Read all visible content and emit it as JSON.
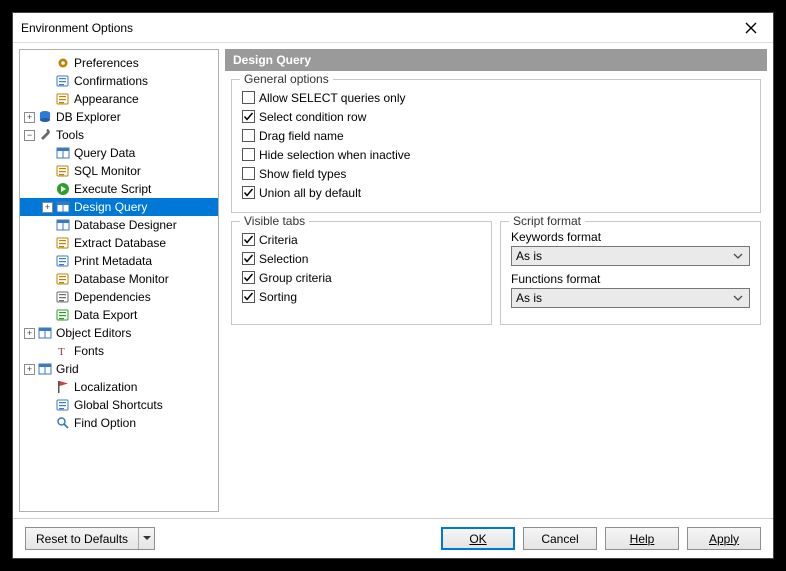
{
  "window": {
    "title": "Environment Options"
  },
  "tree": {
    "items": [
      {
        "label": "Preferences",
        "indent": 1,
        "exp": ""
      },
      {
        "label": "Confirmations",
        "indent": 1,
        "exp": ""
      },
      {
        "label": "Appearance",
        "indent": 1,
        "exp": ""
      },
      {
        "label": "DB Explorer",
        "indent": 0,
        "exp": "+"
      },
      {
        "label": "Tools",
        "indent": 0,
        "exp": "-"
      },
      {
        "label": "Query Data",
        "indent": 1,
        "exp": ""
      },
      {
        "label": "SQL Monitor",
        "indent": 1,
        "exp": ""
      },
      {
        "label": "Execute Script",
        "indent": 1,
        "exp": ""
      },
      {
        "label": "Design Query",
        "indent": 1,
        "exp": "+",
        "selected": true
      },
      {
        "label": "Database Designer",
        "indent": 1,
        "exp": ""
      },
      {
        "label": "Extract Database",
        "indent": 1,
        "exp": ""
      },
      {
        "label": "Print Metadata",
        "indent": 1,
        "exp": ""
      },
      {
        "label": "Database Monitor",
        "indent": 1,
        "exp": ""
      },
      {
        "label": "Dependencies",
        "indent": 1,
        "exp": ""
      },
      {
        "label": "Data Export",
        "indent": 1,
        "exp": ""
      },
      {
        "label": "Object Editors",
        "indent": 0,
        "exp": "+"
      },
      {
        "label": "Fonts",
        "indent": 1,
        "exp": ""
      },
      {
        "label": "Grid",
        "indent": 0,
        "exp": "+"
      },
      {
        "label": "Localization",
        "indent": 1,
        "exp": ""
      },
      {
        "label": "Global Shortcuts",
        "indent": 1,
        "exp": ""
      },
      {
        "label": "Find Option",
        "indent": 1,
        "exp": ""
      }
    ]
  },
  "panel": {
    "header": "Design Query",
    "general": {
      "legend": "General options",
      "items": [
        {
          "label": "Allow SELECT queries only",
          "checked": false
        },
        {
          "label": "Select condition row",
          "checked": true
        },
        {
          "label": "Drag field name",
          "checked": false
        },
        {
          "label": "Hide selection when inactive",
          "checked": false
        },
        {
          "label": "Show field types",
          "checked": false
        },
        {
          "label": "Union all by default",
          "checked": true
        }
      ]
    },
    "visible": {
      "legend": "Visible tabs",
      "items": [
        {
          "label": "Criteria",
          "checked": true
        },
        {
          "label": "Selection",
          "checked": true
        },
        {
          "label": "Group criteria",
          "checked": true
        },
        {
          "label": "Sorting",
          "checked": true
        }
      ]
    },
    "script": {
      "legend": "Script format",
      "keywords_label": "Keywords format",
      "keywords_value": "As is",
      "functions_label": "Functions format",
      "functions_value": "As is"
    }
  },
  "buttons": {
    "reset": "Reset to Defaults",
    "ok": "OK",
    "cancel": "Cancel",
    "help": "Help",
    "apply": "Apply"
  },
  "icons": {
    "gear": "#c08000",
    "wrench": "#6a6a6a",
    "doc": "#d99b3a"
  }
}
